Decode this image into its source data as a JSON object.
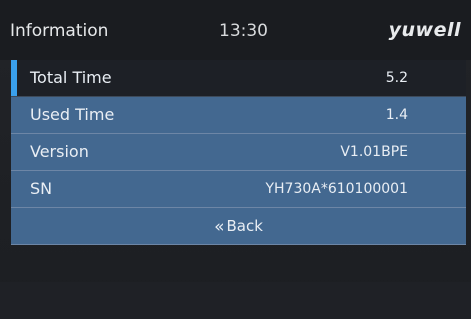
{
  "header": {
    "title": "Information",
    "time": "13:30",
    "brand": "yuwell"
  },
  "info_rows": [
    {
      "label": "Total Time",
      "value": "5.2"
    },
    {
      "label": "Used Time",
      "value": "1.4"
    },
    {
      "label": "Version",
      "value": "V1.01BPE"
    },
    {
      "label": "SN",
      "value": "YH730A*610100001"
    }
  ],
  "back": {
    "icon": "double-chevron-left-icon",
    "label": "Back"
  },
  "colors": {
    "row_bg": "#436890",
    "selected_bg": "#1d2026",
    "accent": "#3aa0ec"
  }
}
